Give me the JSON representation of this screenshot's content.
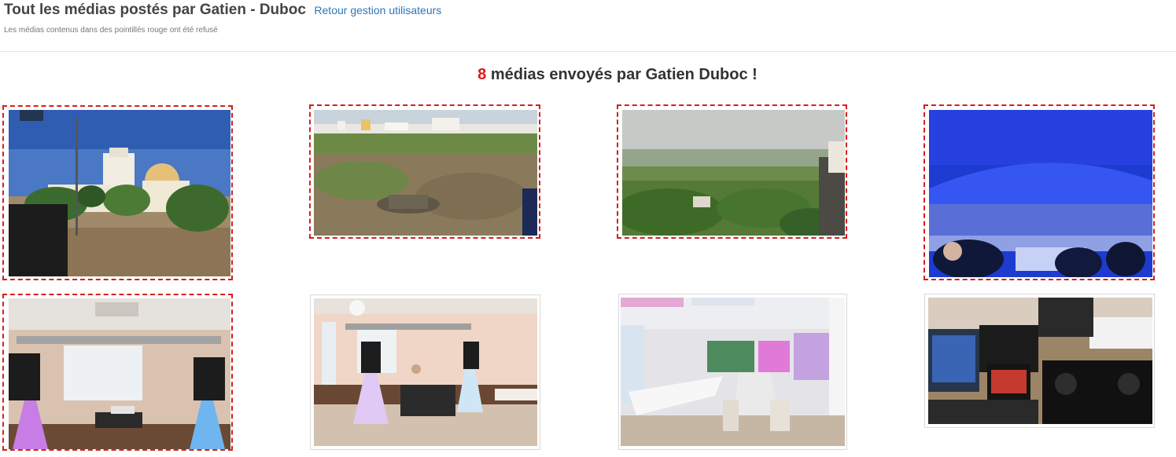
{
  "header": {
    "title": "Tout les médias postés par Gatien - Duboc",
    "back_link": "Retour gestion utilisateurs",
    "subtitle": "Les médias contenus dans des pointillés rouge ont été refusé"
  },
  "summary": {
    "count": "8",
    "text": " médias envoyés par Gatien Duboc !"
  },
  "colors": {
    "refused_border": "#d71d1d",
    "count_accent": "#e1171b",
    "link": "#2f76b5"
  },
  "media": [
    {
      "scene": "spanish-town-building-with-palm-trees",
      "status": "refused"
    },
    {
      "scene": "rocky-field-with-white-village",
      "status": "refused"
    },
    {
      "scene": "green-valley-landscape-view",
      "status": "refused"
    },
    {
      "scene": "blue-lit-arena-concert",
      "status": "refused"
    },
    {
      "scene": "dj-setup-room-lighting-truss",
      "status": "refused"
    },
    {
      "scene": "dj-setup-hall-with-truss",
      "status": "accepted"
    },
    {
      "scene": "banquet-hall-long-tables",
      "status": "accepted"
    },
    {
      "scene": "dj-controller-and-laptops",
      "status": "accepted"
    }
  ]
}
